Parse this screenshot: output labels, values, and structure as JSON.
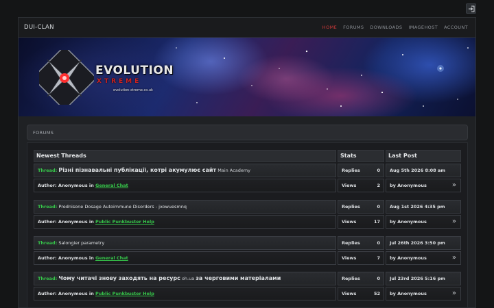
{
  "topbar": {
    "login_icon": "sign-in-icon"
  },
  "navbar": {
    "brand": "DUI-CLAN",
    "links": [
      "HOME",
      "FORUMS",
      "DOWNLOADS",
      "IMAGEHOST",
      "ACCOUNT"
    ],
    "active": "HOME",
    "accent_color": "#d43a3a"
  },
  "banner": {
    "logo_title": "EVOLUTION",
    "logo_sub": "XTREME",
    "logo_url": "evolution-xtreme.co.uk"
  },
  "breadcrumb": "FORUMS",
  "table": {
    "headers": {
      "threads": "Newest Threads",
      "stats": "Stats",
      "last": "Last Post"
    },
    "threads": [
      {
        "thread_label": "Thread:",
        "title": "Різні пізнавальні публікації, котрі акумулює сайт",
        "title_suffix": " Main Academy",
        "author_prefix": "Author: Anonymous in ",
        "forum": "General Chat",
        "replies_label": "Replies",
        "replies": "0",
        "views_label": "Views",
        "views": "2",
        "date": "Aug 5th 2026 8:08 am",
        "by": "by Anonymous"
      },
      {
        "thread_label": "Thread:",
        "title": "Prednisone Dosage Autoimmune Disorders - jxowuesmnq",
        "title_suffix": "",
        "author_prefix": "Author: Anonymous in ",
        "forum": "Public Punkbuster Help",
        "replies_label": "Replies",
        "replies": "0",
        "views_label": "Views",
        "views": "17",
        "date": "Aug 1st 2026 4:35 pm",
        "by": "by Anonymous"
      },
      {
        "thread_label": "Thread:",
        "title": "Salongier parametry",
        "title_suffix": "",
        "author_prefix": "Author: Anonymous in ",
        "forum": "General Chat",
        "replies_label": "Replies",
        "replies": "0",
        "views_label": "Views",
        "views": "7",
        "date": "Jul 26th 2026 3:50 pm",
        "by": "by Anonymous"
      },
      {
        "thread_label": "Thread:",
        "title": "Чому читачі знову заходять на ресурс",
        "title_mid": " oh.ua ",
        "title_end": "за черговими матеріалами",
        "author_prefix": "Author: Anonymous in ",
        "forum": "Public Punkbuster Help",
        "replies_label": "Replies",
        "replies": "0",
        "views_label": "Views",
        "views": "52",
        "date": "Jul 23rd 2026 5:16 pm",
        "by": "by Anonymous"
      }
    ]
  },
  "colors": {
    "link_green": "#36c64a",
    "background": "#141516"
  },
  "icons": {
    "go_to_post": "double-chevron-right-icon"
  }
}
